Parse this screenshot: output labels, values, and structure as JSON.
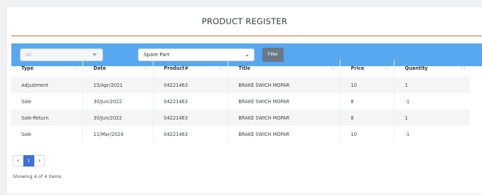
{
  "header": {
    "title": "PRODUCT REGISTER"
  },
  "filters": {
    "type_select": "All",
    "part_select": "Spare Part",
    "filter_button": "Filter"
  },
  "table": {
    "columns": [
      "Type",
      "Date",
      "Product#",
      "Title",
      "Price",
      "Quantity"
    ],
    "rows": [
      [
        "Adjustment",
        "15/Apr/2021",
        "04221463",
        "BRAKE SWICH MOPAR",
        "10",
        "1"
      ],
      [
        "Sale",
        "30/Jun/2022",
        "04221463",
        "BRAKE SWICH MOPAR",
        "8",
        "-1"
      ],
      [
        "Sale-Return",
        "30/Jun/2022",
        "04221463",
        "BRAKE SWICH MOPAR",
        "8",
        "1"
      ],
      [
        "Sale",
        "11/Mar/2024",
        "04221463",
        "BRAKE SWICH MOPAR",
        "10",
        "-1"
      ]
    ]
  },
  "pager": {
    "prev": "‹",
    "current": "1",
    "next": "›"
  },
  "footer": {
    "info": "Showing 4 of 4 items"
  },
  "colors": {
    "accent_bar": "#56a8f0",
    "title_rule": "#e2661f",
    "active_page": "#3f6fd8"
  }
}
